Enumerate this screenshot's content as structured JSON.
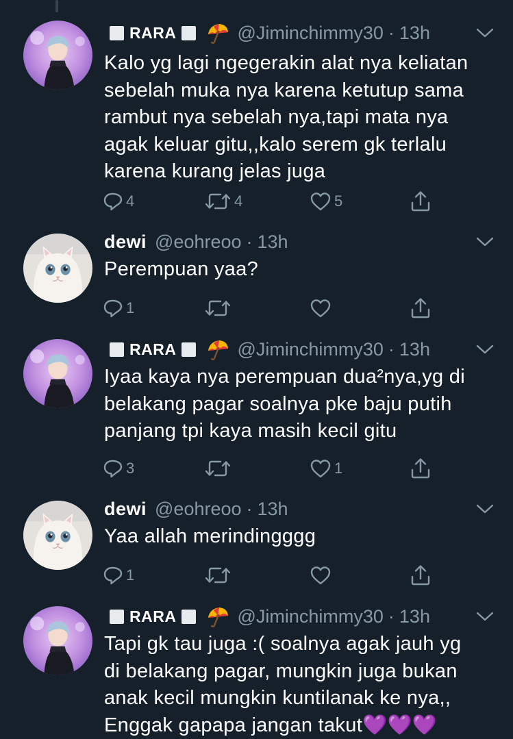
{
  "tweets": [
    {
      "author": "RARA",
      "handle": "@Jiminchimmy30",
      "time": "13h",
      "text": "Kalo yg lagi ngegerakin alat nya keliatan\nsebelah muka nya karena ketutup sama\nrambut nya sebelah nya,tapi mata nya\nagak keluar gitu,,kalo serem gk terlalu\nkarena kurang jelas juga",
      "replies": "4",
      "retweets": "4",
      "likes": "5"
    },
    {
      "author": "dewi",
      "handle": "@eohreoo",
      "time": "13h",
      "text": "Perempuan yaa?",
      "replies": "1",
      "retweets": "",
      "likes": ""
    },
    {
      "author": "RARA",
      "handle": "@Jiminchimmy30",
      "time": "13h",
      "text": "Iyaa kaya nya perempuan dua²nya,yg di\nbelakang pagar soalnya pke baju putih\npanjang tpi kaya masih kecil gitu",
      "replies": "3",
      "retweets": "",
      "likes": "1"
    },
    {
      "author": "dewi",
      "handle": "@eohreoo",
      "time": "13h",
      "text": "Yaa  allah merindingggg",
      "replies": "1",
      "retweets": "",
      "likes": ""
    },
    {
      "author": "RARA",
      "handle": "@Jiminchimmy30",
      "time": "13h",
      "text": "Tapi gk tau juga :( soalnya agak jauh yg\ndi belakang pagar, mungkin juga bukan\nanak kecil mungkin kuntilanak ke nya,,\nEnggak gapapa jangan takut💜💜💜",
      "replies": "",
      "retweets": "",
      "likes": ""
    }
  ],
  "icons": {
    "reply": "reply-icon",
    "retweet": "retweet-icon",
    "like": "heart-icon",
    "share": "share-icon",
    "more": "chevron-down-icon",
    "umbrella": "umbrella-emoji-icon"
  },
  "colors": {
    "background": "#15202b",
    "secondary_text": "#8899a6",
    "thread_line": "#38444d"
  }
}
